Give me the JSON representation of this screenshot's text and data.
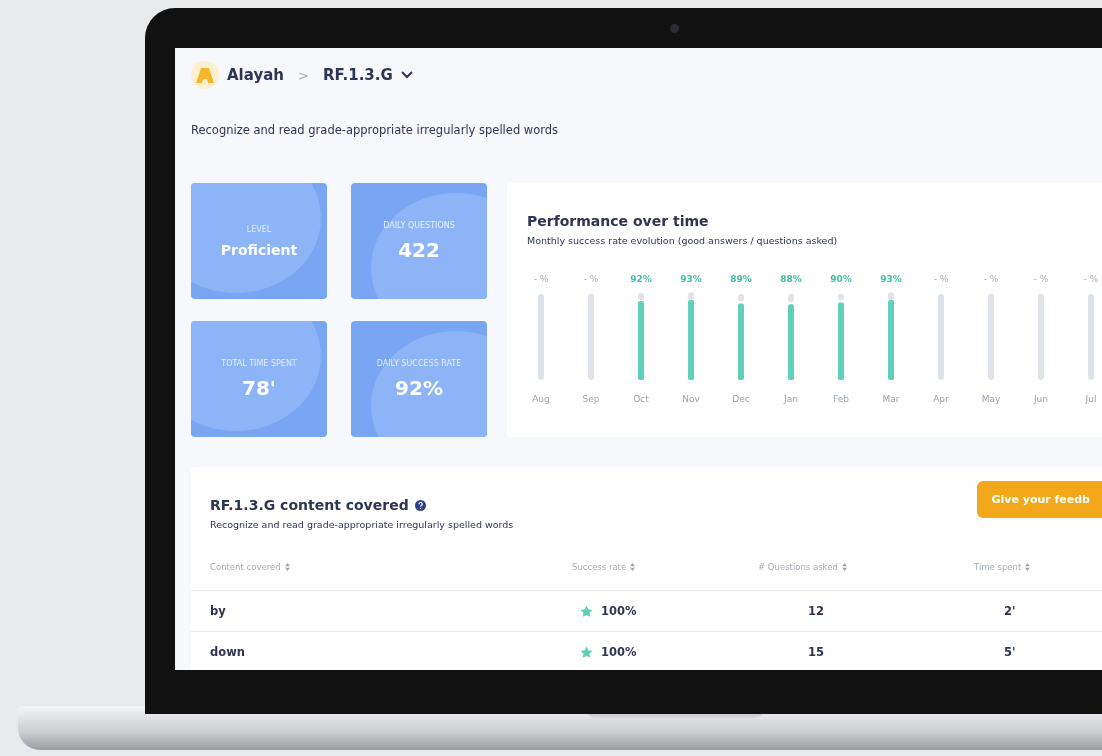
{
  "breadcrumb": {
    "student": "Alayah",
    "separator": ">",
    "standard": "RF.1.3.G"
  },
  "description": "Recognize and read grade-appropriate irregularly spelled words",
  "stats": [
    {
      "label": "LEVEL",
      "value": "Proficient"
    },
    {
      "label": "DAILY QUESTIONS",
      "value": "422"
    },
    {
      "label": "TOTAL TIME SPENT",
      "value": "78'"
    },
    {
      "label": "DAILY SUCCESS RATE",
      "value": "92%"
    }
  ],
  "performance": {
    "title": "Performance over time",
    "subtitle": "Monthly success rate evolution (good answers / questions asked)",
    "chart_data": {
      "type": "bar",
      "categories": [
        "Aug",
        "Sep",
        "Oct",
        "Nov",
        "Dec",
        "Jan",
        "Feb",
        "Mar",
        "Apr",
        "May",
        "Jun",
        "Jul"
      ],
      "values": [
        null,
        null,
        92,
        93,
        89,
        88,
        90,
        93,
        null,
        null,
        null,
        null
      ],
      "ylim": [
        0,
        100
      ],
      "grid": true,
      "value_labels": [
        "- %",
        "- %",
        "92%",
        "93%",
        "89%",
        "88%",
        "90%",
        "93%",
        "- %",
        "- %",
        "- %",
        "- %"
      ]
    }
  },
  "content": {
    "title": "RF.1.3.G content covered",
    "subtitle": "Recognize and read grade-appropriate irregularly spelled words",
    "feedback_button": "Give your feedb",
    "columns": [
      "Content covered",
      "Success rate",
      "# Questions asked",
      "Time spent"
    ],
    "rows": [
      {
        "word": "by",
        "success_rate": "100%",
        "questions": "12",
        "time": "2'"
      },
      {
        "word": "down",
        "success_rate": "100%",
        "questions": "15",
        "time": "5'"
      }
    ]
  }
}
